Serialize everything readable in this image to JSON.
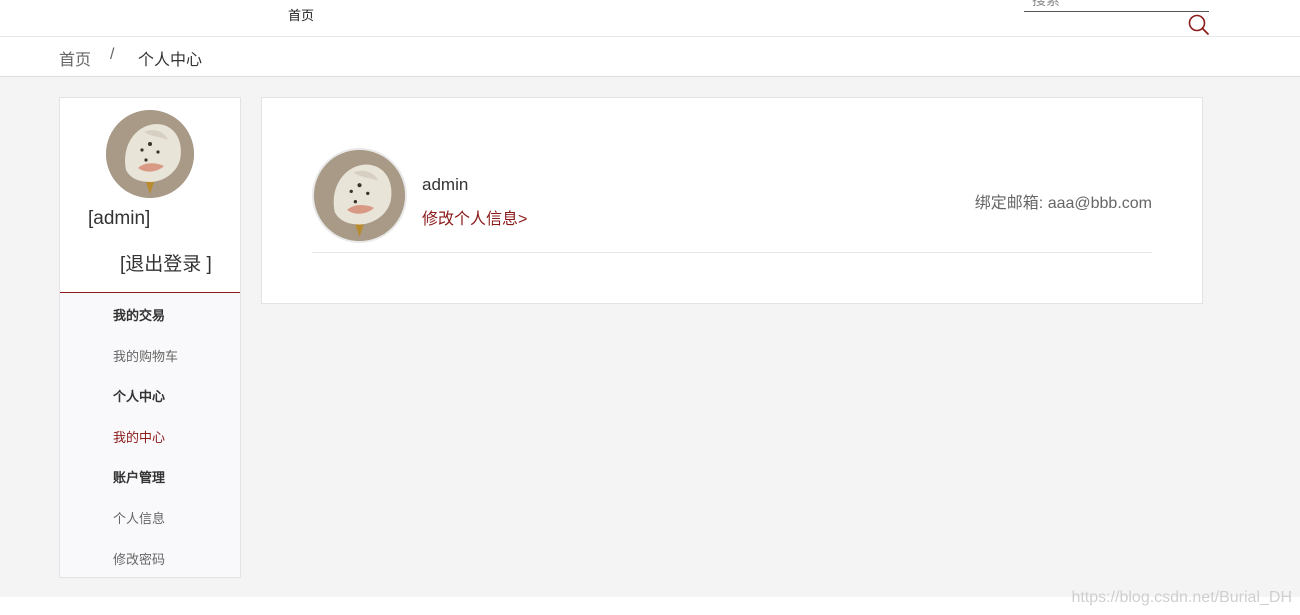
{
  "topnav": {
    "home_label": "首页",
    "search": {
      "placeholder": "搜索",
      "icon": "search-icon"
    },
    "accent_color": "#8b1a1a"
  },
  "breadcrumb": {
    "home": "首页",
    "separator": "/",
    "current": "个人中心"
  },
  "sidebar": {
    "username": "[admin]",
    "logout": "[退出登录 ]",
    "menu": [
      {
        "label": "我的交易",
        "type": "heading"
      },
      {
        "label": "我的购物车",
        "type": "link"
      },
      {
        "label": "个人中心",
        "type": "heading"
      },
      {
        "label": "我的中心",
        "type": "link",
        "active": true
      },
      {
        "label": "账户管理",
        "type": "heading"
      },
      {
        "label": "个人信息",
        "type": "link"
      },
      {
        "label": "修改密码",
        "type": "link"
      }
    ]
  },
  "profile": {
    "username": "admin",
    "edit_link": "修改个人信息>",
    "email_label": "绑定邮箱: aaa@bbb.com"
  },
  "watermark": "https://blog.csdn.net/Burial_DH"
}
